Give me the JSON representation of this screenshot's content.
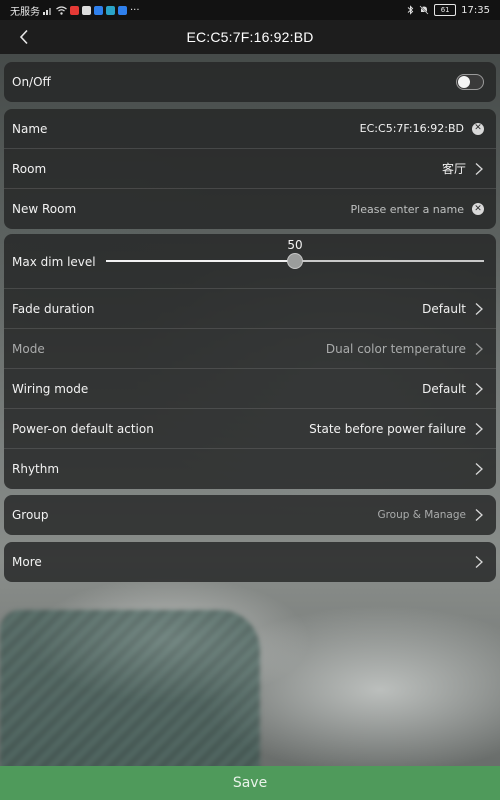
{
  "status_bar": {
    "carrier": "无服务",
    "more": "···",
    "battery": "61",
    "time": "17:35"
  },
  "header": {
    "title": "EC:C5:7F:16:92:BD"
  },
  "power": {
    "label": "On/Off",
    "on": false
  },
  "info": {
    "name_label": "Name",
    "name_value": "EC:C5:7F:16:92:BD",
    "room_label": "Room",
    "room_value": "客厅",
    "new_room_label": "New Room",
    "new_room_placeholder": "Please enter a name"
  },
  "settings": {
    "max_dim_label": "Max dim level",
    "max_dim_value": "50",
    "max_dim_min": 0,
    "max_dim_max": 100,
    "fade_label": "Fade duration",
    "fade_value": "Default",
    "mode_label": "Mode",
    "mode_value": "Dual color temperature",
    "wiring_label": "Wiring mode",
    "wiring_value": "Default",
    "power_on_label": "Power-on default action",
    "power_on_value": "State before power failure",
    "rhythm_label": "Rhythm"
  },
  "group": {
    "label": "Group",
    "value": "Group & Manage"
  },
  "more": {
    "label": "More"
  },
  "save_label": "Save"
}
